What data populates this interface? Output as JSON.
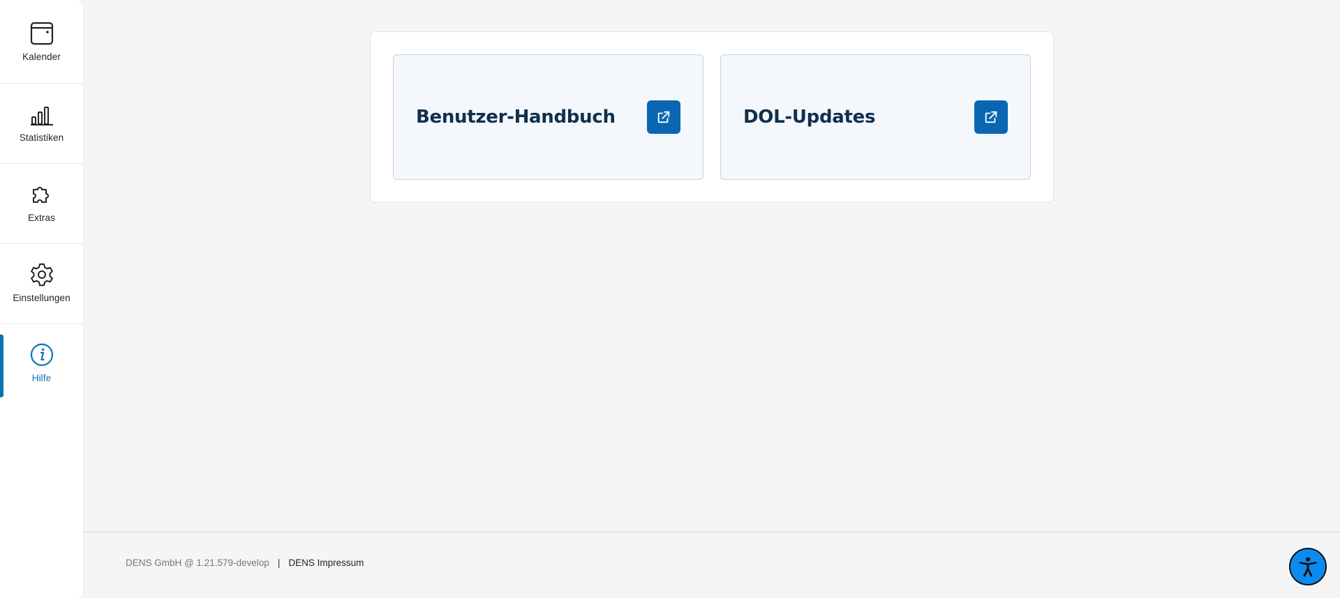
{
  "sidebar": {
    "items": [
      {
        "label": "Kalender",
        "icon": "calendar-icon"
      },
      {
        "label": "Statistiken",
        "icon": "bar-chart-icon"
      },
      {
        "label": "Extras",
        "icon": "puzzle-icon"
      },
      {
        "label": "Einstellungen",
        "icon": "gear-icon"
      },
      {
        "label": "Hilfe",
        "icon": "info-icon",
        "active": true
      }
    ]
  },
  "main": {
    "cards": [
      {
        "title": "Benutzer-Handbuch",
        "icon": "external-link-icon"
      },
      {
        "title": "DOL-Updates",
        "icon": "external-link-icon"
      }
    ]
  },
  "footer": {
    "version_text": "DENS GmbH @ 1.21.579-develop",
    "separator": "|",
    "impressum_label": "DENS Impressum"
  },
  "accessibility": {
    "icon": "accessibility-icon"
  },
  "colors": {
    "accent": "#0a73b5",
    "button": "#0a66b2",
    "card_title": "#0f2f4d",
    "a11y_button": "#0b8bf0"
  }
}
